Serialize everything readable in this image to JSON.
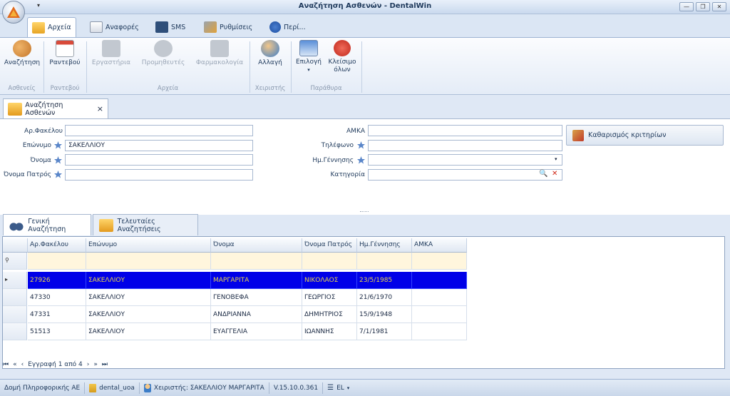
{
  "window": {
    "title": "Αναζήτηση Ασθενών - DentalWin"
  },
  "qat": {
    "dropdown": "▾"
  },
  "ribbon_tabs": [
    {
      "label": "Αρχεία",
      "icon": "folder-icon"
    },
    {
      "label": "Αναφορές",
      "icon": "reports-icon"
    },
    {
      "label": "SMS",
      "icon": "sms-icon"
    },
    {
      "label": "Ρυθμίσεις",
      "icon": "tools-icon"
    },
    {
      "label": "Περί...",
      "icon": "info-icon"
    }
  ],
  "ribbon": {
    "search": "Αναζήτηση",
    "appointments": "Ραντεβού",
    "labs": "Εργαστήρια",
    "suppliers": "Προμηθευτές",
    "pharmacology": "Φαρμακολογία",
    "change": "Αλλαγή",
    "options": "Επιλογή",
    "close_all_1": "Κλείσιμο",
    "close_all_2": "όλων",
    "groups": {
      "patients": "Ασθενείς",
      "appointments": "Ραντεβού",
      "files": "Αρχεία",
      "operator": "Χειριστής",
      "window": "Παράθυρα"
    }
  },
  "doc_tab": {
    "label": "Αναζήτηση Ασθενών",
    "close": "×"
  },
  "form": {
    "file_no_label": "Αρ.Φακέλου",
    "surname_label": "Επώνυμο",
    "surname_value": "ΣΑΚΕΛΛΙΟΥ",
    "name_label": "Όνομα",
    "father_label": "Όνομα Πατρός",
    "amka_label": "ΑΜΚΑ",
    "phone_label": "Τηλέφωνο",
    "dob_label": "Ημ.Γέννησης",
    "category_label": "Κατηγορία",
    "clear_button": "Καθαρισμός κριτηρίων"
  },
  "search_tabs": [
    {
      "label": "Γενική Αναζήτηση"
    },
    {
      "label": "Τελευταίες Αναζητήσεις"
    }
  ],
  "grid": {
    "columns": [
      "Αρ.Φακέλου",
      "Επώνυμο",
      "Όνομα",
      "Όνομα Πατρός",
      "Ημ.Γέννησης",
      "ΑΜΚΑ"
    ],
    "rows": [
      [
        "27926",
        "ΣΑΚΕΛΛΙΟΥ",
        "ΜΑΡΓΑΡΙΤΑ",
        "ΝΙΚΟΛΑΟΣ",
        "23/5/1985",
        ""
      ],
      [
        "47330",
        "ΣΑΚΕΛΛΙΟΥ",
        "ΓΕΝΟΒΕΦΑ",
        "ΓΕΩΡΓΙΟΣ",
        "21/6/1970",
        ""
      ],
      [
        "47331",
        "ΣΑΚΕΛΛΙΟΥ",
        "ΑΝΔΡΙΑΝΝΑ",
        "ΔΗΜΗΤΡΙΟΣ",
        "15/9/1948",
        ""
      ],
      [
        "51513",
        "ΣΑΚΕΛΛΙΟΥ",
        "ΕΥΑΓΓΕΛΙΑ",
        "ΙΩΑΝΝΗΣ",
        "7/1/1981",
        ""
      ]
    ],
    "record_text": "Εγγραφή 1 από 4"
  },
  "status": {
    "company": "Δομή Πληροφορικής ΑΕ",
    "database": "dental_uoa",
    "operator": "Χειριστής: ΣΑΚΕΛΛΙΟΥ ΜΑΡΓΑΡΙΤΑ",
    "version": "V.15.10.0.361",
    "language": "EL"
  },
  "colors": {
    "selected_row_bg": "#0000e8",
    "selected_row_text": "#e8d24a",
    "accent": "#1e395b"
  }
}
